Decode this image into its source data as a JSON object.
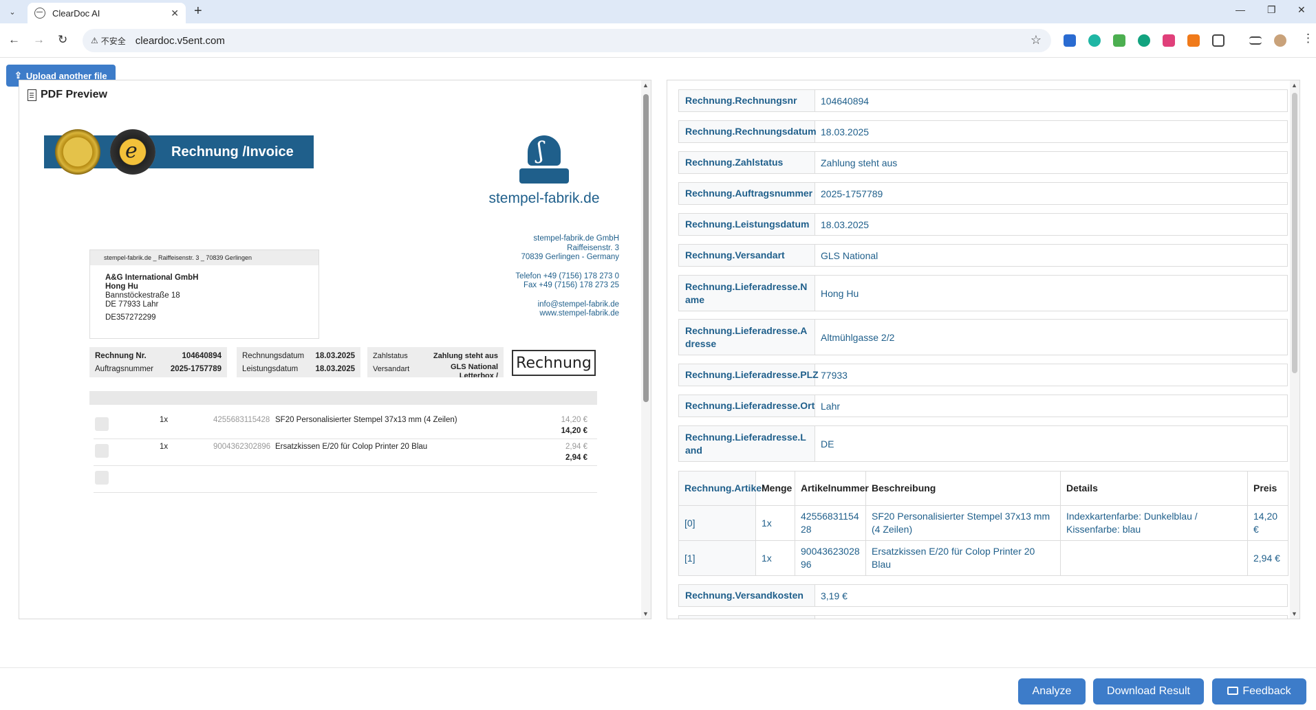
{
  "browser": {
    "tab_title": "ClearDoc AI",
    "tab_close": "✕",
    "new_tab": "+",
    "insecure_label": "不安全",
    "url": "cleardoc.v5ent.com"
  },
  "app": {
    "upload_button": "Upload another file",
    "pdf_preview_title": "PDF Preview"
  },
  "pdf": {
    "banner_title": "Rechnung /Invoice",
    "seal_letter": "e",
    "logo_glyph": "ʃ",
    "logo_text": "stempel-fabrik.de",
    "sender_lines": [
      "stempel-fabrik.de GmbH",
      "Raiffeisenstr. 3",
      "70839 Gerlingen - Germany"
    ],
    "sender_contact": [
      "Telefon +49 (7156) 178 273 0",
      "Fax +49 (7156) 178 273 25"
    ],
    "sender_web": [
      "info@stempel-fabrik.de",
      "www.stempel-fabrik.de"
    ],
    "return_address": "stempel-fabrik.de _ Raiffeisenstr. 3 _ 70839 Gerlingen",
    "recipient": {
      "company": "A&G International GmbH",
      "name": "Hong Hu",
      "street": "Bannstöckestraße 18",
      "city": "DE 77933 Lahr",
      "vat": "DE357272299"
    },
    "meta": {
      "rechnung_nr_label": "Rechnung Nr.",
      "rechnung_nr": "104640894",
      "auftragsnummer_label": "Auftragsnummer",
      "auftragsnummer": "2025-1757789",
      "rechnungsdatum_label": "Rechnungsdatum",
      "rechnungsdatum": "18.03.2025",
      "leistungsdatum_label": "Leistungsdatum",
      "leistungsdatum": "18.03.2025",
      "zahlstatus_label": "Zahlstatus",
      "zahlstatus": "Zahlung steht aus",
      "versandart_label": "Versandart",
      "versandart": "GLS National Letterbox / Deposit"
    },
    "stamp_label": "Rechnung",
    "lines": [
      {
        "qty": "1x",
        "art": "4255683115428",
        "desc": "SF20 Personalisierter Stempel 37x13 mm (4 Zeilen)",
        "unit": "14,20 €",
        "total": "14,20 €"
      },
      {
        "qty": "1x",
        "art": "9004362302896",
        "desc": "Ersatzkissen E/20 für Colop Printer 20 Blau",
        "unit": "2,94 €",
        "total": "2,94 €"
      }
    ]
  },
  "result": {
    "fields": [
      {
        "key": "Rechnung.Rechnungsnr",
        "value": "104640894"
      },
      {
        "key": "Rechnung.Rechnungsdatum",
        "value": "18.03.2025"
      },
      {
        "key": "Rechnung.Zahlstatus",
        "value": "Zahlung steht aus"
      },
      {
        "key": "Rechnung.Auftragsnummer",
        "value": "2025-1757789"
      },
      {
        "key": "Rechnung.Leistungsdatum",
        "value": "18.03.2025"
      },
      {
        "key": "Rechnung.Versandart",
        "value": "GLS National"
      },
      {
        "key": "Rechnung.Lieferadresse.Name",
        "value": "Hong Hu"
      },
      {
        "key": "Rechnung.Lieferadresse.Adresse",
        "value": "Altmühlgasse 2/2"
      },
      {
        "key": "Rechnung.Lieferadresse.PLZ",
        "value": "77933"
      },
      {
        "key": "Rechnung.Lieferadresse.Ort",
        "value": "Lahr"
      },
      {
        "key": "Rechnung.Lieferadresse.Land",
        "value": "DE"
      }
    ],
    "items_table": {
      "headers": [
        "Rechnung.Artikel",
        "Menge",
        "Artikelnummer",
        "Beschreibung",
        "Details",
        "Preis"
      ],
      "rows": [
        [
          "[0]",
          "1x",
          "4255683115428",
          "SF20 Personalisierter Stempel 37x13 mm (4 Zeilen)",
          "Indexkartenfarbe: Dunkelblau / Kissenfarbe: blau",
          "14,20 €"
        ],
        [
          "[1]",
          "1x",
          "9004362302896",
          "Ersatzkissen E/20 für Colop Printer 20 Blau",
          "",
          "2,94 €"
        ]
      ]
    },
    "versandkosten": {
      "key": "Rechnung.Versandkosten",
      "value": "3,19 €"
    }
  },
  "footer": {
    "analyze": "Analyze",
    "download": "Download Result",
    "feedback": "Feedback"
  },
  "colors": {
    "accent": "#3d7cc9",
    "brand": "#1f5f8b",
    "tabbar": "#dfe9f7"
  }
}
